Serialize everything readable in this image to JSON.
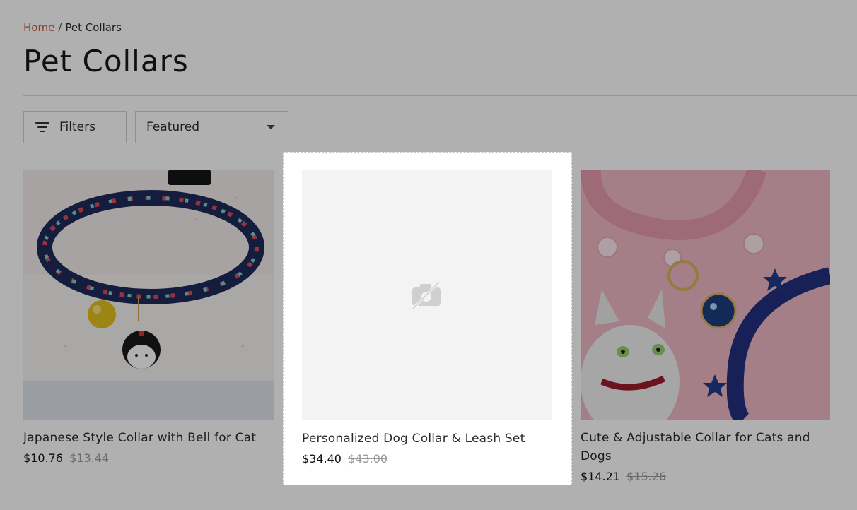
{
  "breadcrumb": {
    "home": "Home",
    "separator": "/",
    "current": "Pet Collars"
  },
  "page_title": "Pet Collars",
  "toolbar": {
    "filters_label": "Filters",
    "sort_selected": "Featured"
  },
  "products": [
    {
      "title": "Japanese Style Collar with Bell for Cat",
      "price": "$10.76",
      "compare_price": "$13.44"
    },
    {
      "title": "Personalized Dog Collar & Leash Set",
      "price": "$34.40",
      "compare_price": "$43.00"
    },
    {
      "title": "Cute & Adjustable Collar for Cats and Dogs",
      "price": "$14.21",
      "compare_price": "$15.26"
    }
  ],
  "colors": {
    "accent_link": "#c9603d",
    "overlay": "rgba(0,0,0,0.31)",
    "compare_price": "#9a9a9a"
  },
  "icons": [
    "filters-icon",
    "chevron-down-icon",
    "image-placeholder-icon"
  ]
}
